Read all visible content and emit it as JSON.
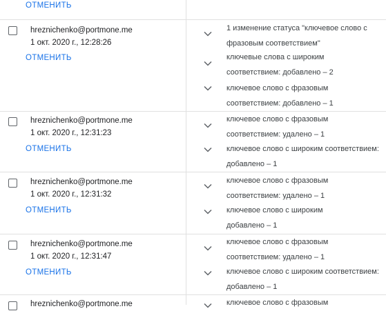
{
  "undo_label": "ОТМЕНИТЬ",
  "rows": [
    {
      "email": "hreznichenko@portmone.me",
      "time": "1 окт. 2020 г., 12:28:26",
      "changes": [
        {
          "line1": "1 изменение статуса \"ключевое слово с",
          "line2": "фразовым соответствием\""
        },
        {
          "line1": "ключевые слова с широким",
          "line2": "соответствием: добавлено – 2"
        },
        {
          "line1": "ключевое слово с фразовым",
          "line2": "соответствием: добавлено – 1"
        }
      ]
    },
    {
      "email": "hreznichenko@portmone.me",
      "time": "1 окт. 2020 г., 12:31:23",
      "changes": [
        {
          "line1": "ключевое слово с фразовым",
          "line2": "соответствием: удалено – 1"
        },
        {
          "line1": "ключевое слово с широким соответствием:",
          "line2": "добавлено – 1"
        }
      ]
    },
    {
      "email": "hreznichenko@portmone.me",
      "time": "1 окт. 2020 г., 12:31:32",
      "changes": [
        {
          "line1": "ключевое слово с фразовым",
          "line2": "соответствием: удалено – 1"
        },
        {
          "line1": "ключевое слово с широким",
          "line2": "добавлено – 1"
        }
      ]
    },
    {
      "email": "hreznichenko@portmone.me",
      "time": "1 окт. 2020 г., 12:31:47",
      "changes": [
        {
          "line1": "ключевое слово с фразовым",
          "line2": "соответствием: удалено – 1"
        },
        {
          "line1": "ключевое слово с широким соответствием:",
          "line2": "добавлено – 1"
        }
      ]
    },
    {
      "email": "hreznichenko@portmone.me",
      "changes": [
        {
          "line1": "ключевое слово с фразовым"
        }
      ]
    }
  ]
}
